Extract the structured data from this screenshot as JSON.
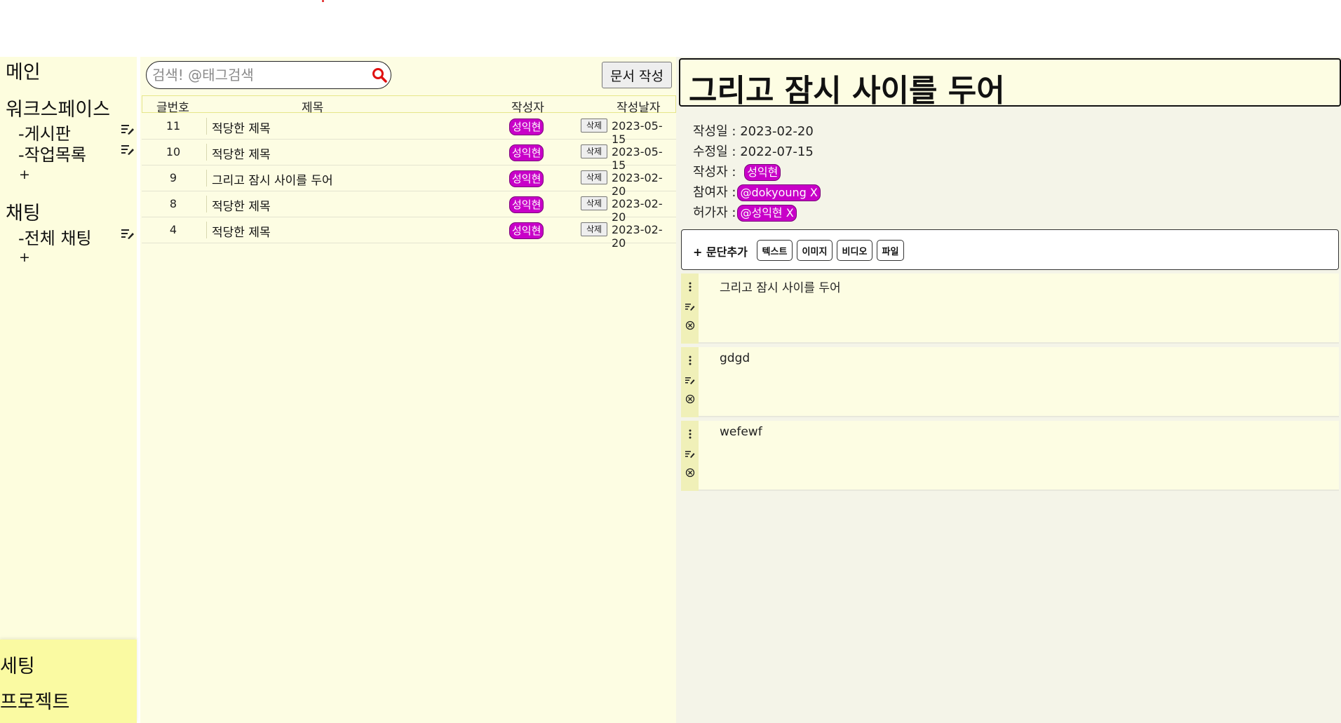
{
  "sidebar": {
    "main_label": "메인",
    "workspace_label": "워크스페이스",
    "workspace_items": [
      {
        "label": "-게시판",
        "icon": "edit-icon"
      },
      {
        "label": "-작업목록",
        "icon": "edit-icon"
      }
    ],
    "workspace_add": "+",
    "chat_label": "채팅",
    "chat_items": [
      {
        "label": "-전체 채팅",
        "icon": "edit-icon"
      }
    ],
    "chat_add": "+",
    "settings_label": "세팅",
    "project_label": "프로젝트"
  },
  "list": {
    "search": {
      "placeholder": "검색! @태그검색",
      "value": "",
      "icon": "search-icon"
    },
    "write_button": "문서 작성",
    "columns": {
      "num": "글번호",
      "title": "제목",
      "author": "작성자",
      "date": "작성날자"
    },
    "delete_label": "삭제",
    "rows": [
      {
        "num": "11",
        "title": "적당한 제목",
        "author": "성익현",
        "date": "2023-05-15"
      },
      {
        "num": "10",
        "title": "적당한 제목",
        "author": "성익현",
        "date": "2023-05-15"
      },
      {
        "num": "9",
        "title": "그리고 잠시 사이를 두어",
        "author": "성익현",
        "date": "2023-02-20"
      },
      {
        "num": "8",
        "title": "적당한 제목",
        "author": "성익현",
        "date": "2023-02-20"
      },
      {
        "num": "4",
        "title": "적당한 제목",
        "author": "성익현",
        "date": "2023-02-20"
      }
    ]
  },
  "detail": {
    "title": "그리고 잠시 사이를 두어",
    "created_label": "작성일 : ",
    "created": "2023-02-20",
    "modified_label": "수정일 : ",
    "modified": "2022-07-15",
    "author_label": "작성자 : ",
    "author": "성익현",
    "participants_label": "참여자 :",
    "participant": "@dokyoung X",
    "permitted_label": "허가자 :",
    "permitted": "@성익현 X",
    "add_paragraph_label": "+ 문단추가",
    "paragraph_types": [
      "텍스트",
      "이미지",
      "비디오",
      "파일"
    ],
    "paragraphs": [
      {
        "text": "그리고 잠시 사이를 두어"
      },
      {
        "text": "gdgd"
      },
      {
        "text": "wefewf"
      }
    ]
  },
  "colors": {
    "badge": "#c800c8",
    "sidebar_bg": "#fdfdde",
    "sidebar_bottom_bg": "#fafaa2",
    "list_bg": "#fdfde3",
    "detail_bg": "#f4f4e8",
    "search_icon": "#e01010"
  }
}
